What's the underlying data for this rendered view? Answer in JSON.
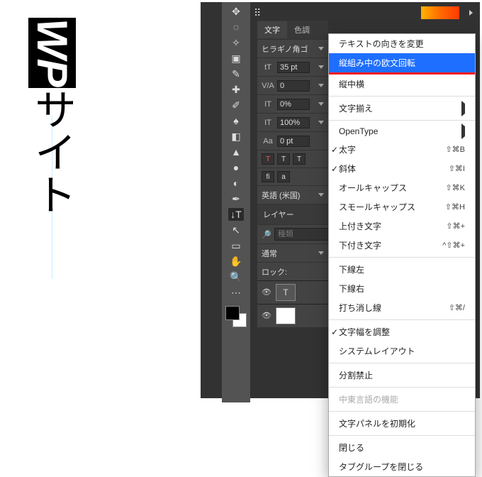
{
  "canvas": {
    "selected_text": "WP",
    "rest_text": "サイト"
  },
  "tabs": {
    "character": "文字",
    "other": "色調"
  },
  "character_panel": {
    "font": "ヒラギノ角ゴ",
    "size_label": "tT",
    "size": "35 pt",
    "va_label": "V/A",
    "va_value": "0",
    "tracking_label": "IT",
    "tracking_value": "0%",
    "scale_label": "IT",
    "scale_value": "100%",
    "baseline_label": "Aa",
    "baseline_value": "0 pt",
    "style_buttons": [
      "T",
      "T",
      "T"
    ],
    "liga_buttons": [
      "fi",
      "a"
    ],
    "language": "英語 (米国)"
  },
  "layers_panel": {
    "title": "レイヤー",
    "search_placeholder": "種類",
    "blend_mode": "通常",
    "lock_label": "ロック:",
    "text_layer_icon": "T"
  },
  "menu": {
    "items": [
      {
        "label": "テキストの向きを変更",
        "type": "item"
      },
      {
        "label": "縦組み中の欧文回転",
        "type": "highlight"
      },
      {
        "label": "縦中横",
        "type": "item"
      },
      {
        "type": "sep"
      },
      {
        "label": "文字揃え",
        "type": "submenu"
      },
      {
        "type": "sep"
      },
      {
        "label": "OpenType",
        "type": "submenu"
      },
      {
        "label": "太字",
        "type": "check",
        "shortcut": "⇧⌘B"
      },
      {
        "label": "斜体",
        "type": "check",
        "shortcut": "⇧⌘I"
      },
      {
        "label": "オールキャップス",
        "type": "item",
        "shortcut": "⇧⌘K"
      },
      {
        "label": "スモールキャップス",
        "type": "item",
        "shortcut": "⇧⌘H"
      },
      {
        "label": "上付き文字",
        "type": "item",
        "shortcut": "⇧⌘+"
      },
      {
        "label": "下付き文字",
        "type": "item",
        "shortcut": "^⇧⌘+"
      },
      {
        "type": "sep"
      },
      {
        "label": "下線左",
        "type": "item"
      },
      {
        "label": "下線右",
        "type": "item"
      },
      {
        "label": "打ち消し線",
        "type": "item",
        "shortcut": "⇧⌘/"
      },
      {
        "type": "sep"
      },
      {
        "label": "文字幅を調整",
        "type": "check"
      },
      {
        "label": "システムレイアウト",
        "type": "item"
      },
      {
        "type": "sep"
      },
      {
        "label": "分割禁止",
        "type": "item"
      },
      {
        "type": "sep"
      },
      {
        "label": "中東言語の機能",
        "type": "disabled"
      },
      {
        "type": "sep"
      },
      {
        "label": "文字パネルを初期化",
        "type": "item"
      },
      {
        "type": "sep"
      },
      {
        "label": "閉じる",
        "type": "item"
      },
      {
        "label": "タブグループを閉じる",
        "type": "item"
      }
    ]
  },
  "toolbar_icons": [
    "move",
    "lasso",
    "wand",
    "crop",
    "eyedrop",
    "heal",
    "brush",
    "stamp",
    "eraser",
    "gradient",
    "blur",
    "dodge",
    "pen",
    "vtype",
    "path",
    "rect",
    "hand",
    "zoom",
    "edit3d",
    "camera"
  ]
}
